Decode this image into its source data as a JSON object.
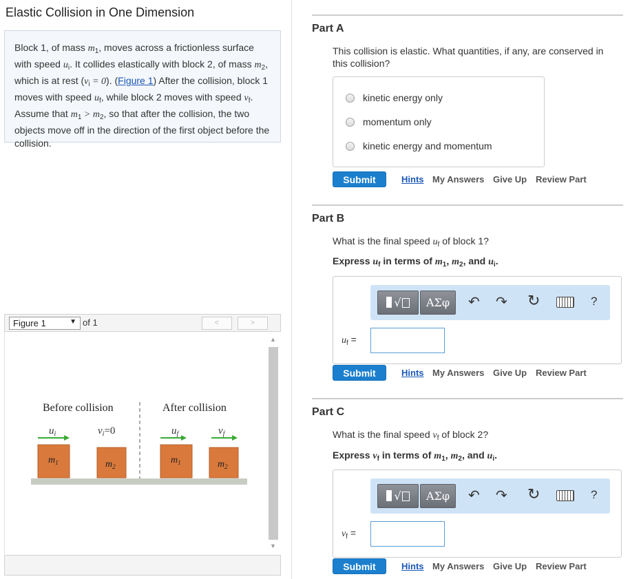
{
  "title": "Elastic Collision in One Dimension",
  "problem": {
    "t1": "Block 1, of mass ",
    "m1": "m",
    "m1_sub": "1",
    "t2": ", moves across a frictionless surface with speed ",
    "ui": "u",
    "ui_sub": "i",
    "t3": ". It collides elastically with block 2, of mass ",
    "m2": "m",
    "m2_sub": "2",
    "t4": ", which is at rest (",
    "vi_expr": "v",
    "vi_sub": "i",
    "vi_eq": " = 0",
    "t5": "). (",
    "fig_link": "Figure 1",
    "t6": ") After the collision, block 1 moves with speed ",
    "uf": "u",
    "uf_sub": "f",
    "t7": ", while block 2 moves with speed ",
    "vf": "v",
    "vf_sub": "f",
    "t8": ". Assume that ",
    "cmp": "m",
    "cmp_sub1": "1",
    "cmp_gt": " > m",
    "cmp_sub2": "2",
    "t9": ", so that after the collision, the two objects move off in the direction of the first object before the collision."
  },
  "figure": {
    "selected": "Figure 1",
    "of": "of 1",
    "prev": "<",
    "next": ">",
    "before_label": "Before collision",
    "after_label": "After collision",
    "ui_label": "u",
    "ui_sub": "i",
    "vi_label": "v",
    "vi_sub": "i",
    "vi_eq": "=0",
    "uf_label": "u",
    "uf_sub": "f",
    "vf_label": "v",
    "vf_sub": "f",
    "m1_label": "m",
    "m1_sub": "1",
    "m2_label": "m",
    "m2_sub": "2",
    "block_color": "#d9793c",
    "floor_color": "#c8cdc4",
    "arrow_color": "#3aa935"
  },
  "partA": {
    "label": "Part A",
    "question": "This collision is elastic. What quantities, if any, are conserved in this collision?",
    "options": [
      "kinetic energy only",
      "momentum only",
      "kinetic energy and momentum"
    ],
    "submit": "Submit",
    "hints": "Hints",
    "my_answers": "My Answers",
    "give_up": "Give Up",
    "review": "Review Part"
  },
  "partB": {
    "label": "Part B",
    "q1": "What is the final speed ",
    "q_var": "u",
    "q_sub": "f",
    "q2": " of block 1?",
    "e1": "Express ",
    "e_var": "u",
    "e_sub": "f",
    "e2": " in terms of ",
    "e_m1": "m",
    "e_m1s": "1",
    "e_c1": ", ",
    "e_m2": "m",
    "e_m2s": "2",
    "e_and": ", and ",
    "e_u": "u",
    "e_us": "i",
    "e_end": ".",
    "sym_btn": "ΑΣφ",
    "help": "?",
    "ans_var": "u",
    "ans_sub": "f",
    "ans_eq": " =",
    "submit": "Submit",
    "hints": "Hints",
    "my_answers": "My Answers",
    "give_up": "Give Up",
    "review": "Review Part"
  },
  "partC": {
    "label": "Part C",
    "q1": "What is the final speed ",
    "q_var": "v",
    "q_sub": "f",
    "q2": " of block 2?",
    "e1": "Express ",
    "e_var": "v",
    "e_sub": "f",
    "e2": " in terms of ",
    "e_m1": "m",
    "e_m1s": "1",
    "e_c1": ", ",
    "e_m2": "m",
    "e_m2s": "2",
    "e_and": ", and ",
    "e_u": "u",
    "e_us": "i",
    "e_end": ".",
    "sym_btn": "ΑΣφ",
    "help": "?",
    "ans_var": "v",
    "ans_sub": "f",
    "ans_eq": " =",
    "submit": "Submit",
    "hints": "Hints",
    "my_answers": "My Answers",
    "give_up": "Give Up",
    "review": "Review Part"
  },
  "colors": {
    "submit_bg": "#1b7fce",
    "toolbar_bg": "#cfe3f6",
    "link": "#1a57b8"
  }
}
